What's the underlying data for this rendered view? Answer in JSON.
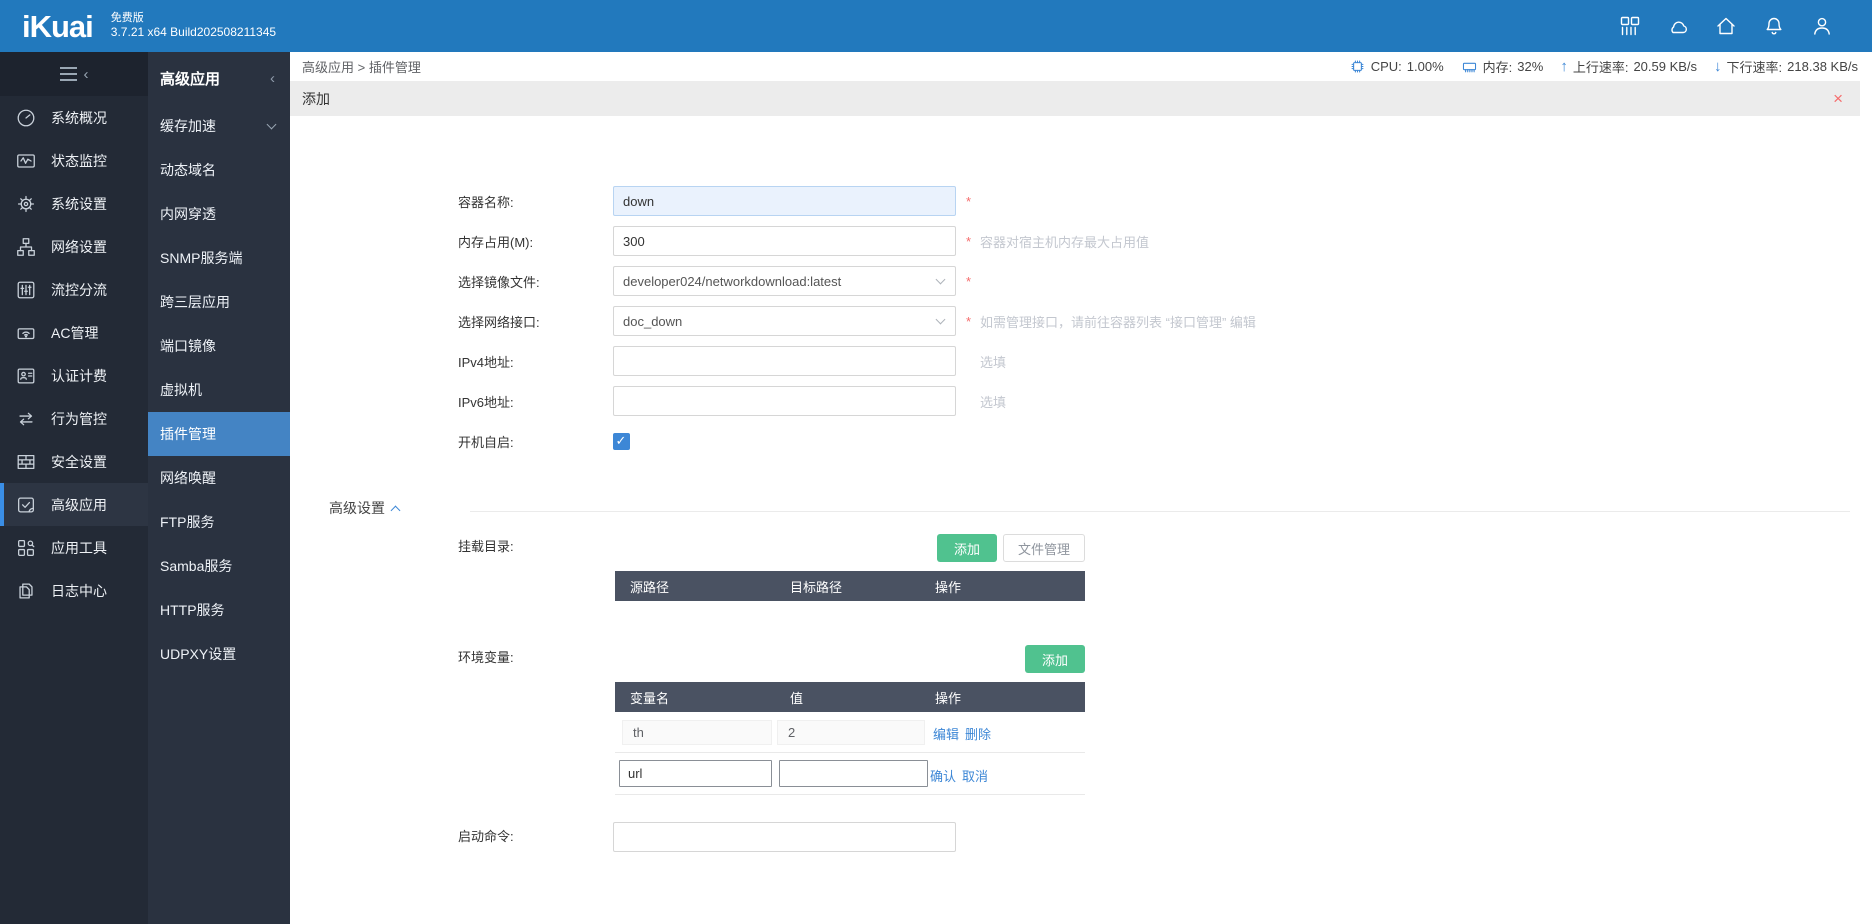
{
  "topbar": {
    "logo": "iKuai",
    "edition": "免费版",
    "version": "3.7.21 x64 Build202508211345"
  },
  "sidebar": {
    "items": [
      {
        "label": "系统概况",
        "icon": "gauge-icon"
      },
      {
        "label": "状态监控",
        "icon": "monitor-pulse-icon"
      },
      {
        "label": "系统设置",
        "icon": "gear-icon"
      },
      {
        "label": "网络设置",
        "icon": "network-icon"
      },
      {
        "label": "流控分流",
        "icon": "sliders-icon"
      },
      {
        "label": "AC管理",
        "icon": "wifi-device-icon"
      },
      {
        "label": "认证计费",
        "icon": "id-card-icon"
      },
      {
        "label": "行为管控",
        "icon": "swap-arrows-icon"
      },
      {
        "label": "安全设置",
        "icon": "firewall-icon"
      },
      {
        "label": "高级应用",
        "icon": "app-check-icon",
        "active": true
      },
      {
        "label": "应用工具",
        "icon": "tools-icon"
      },
      {
        "label": "日志中心",
        "icon": "logs-icon"
      }
    ]
  },
  "submenu": {
    "title": "高级应用",
    "active": "插件管理",
    "items": [
      "缓存加速",
      "动态域名",
      "内网穿透",
      "SNMP服务端",
      "跨三层应用",
      "端口镜像",
      "虚拟机",
      "插件管理",
      "网络唤醒",
      "FTP服务",
      "Samba服务",
      "HTTP服务",
      "UDPXY设置"
    ]
  },
  "header": {
    "breadcrumb": "高级应用 > 插件管理",
    "status": [
      {
        "label": "CPU:",
        "value": "1.00%"
      },
      {
        "label": "内存:",
        "value": "32%"
      },
      {
        "label": "上行速率:",
        "value": "20.59 KB/s"
      },
      {
        "label": "下行速率:",
        "value": "218.38 KB/s"
      }
    ]
  },
  "panel": {
    "title": "添加",
    "close": "×"
  },
  "form": {
    "rows": [
      {
        "label": "容器名称:",
        "value": "down",
        "required": "*"
      },
      {
        "label": "内存占用(M):",
        "value": "300",
        "required": "*",
        "hint": "容器对宿主机内存最大占用值"
      },
      {
        "label": "选择镜像文件:",
        "value": "developer024/networkdownload:latest",
        "required": "*"
      },
      {
        "label": "选择网络接口:",
        "value": "doc_down",
        "required": "*",
        "hint": "如需管理接口，请前往容器列表 “接口管理” 编辑"
      },
      {
        "label": "IPv4地址:",
        "value": "",
        "hint": "选填"
      },
      {
        "label": "IPv6地址:",
        "value": "",
        "hint": "选填"
      },
      {
        "label": "开机自启:",
        "checked": true
      }
    ]
  },
  "advanced": {
    "title": "高级设置",
    "mount": {
      "label": "挂载目录:",
      "add_button": "添加",
      "file_button": "文件管理",
      "headers": [
        "源路径",
        "目标路径",
        "操作"
      ]
    },
    "env": {
      "label": "环境变量:",
      "add_button": "添加",
      "headers": [
        "变量名",
        "值",
        "操作"
      ],
      "row": {
        "name": "th",
        "value": "2",
        "edit": "编辑",
        "delete": "删除"
      },
      "editing": {
        "name": "url",
        "value": "",
        "confirm": "确认",
        "cancel": "取消"
      }
    },
    "command": {
      "label": "启动命令:",
      "value": ""
    }
  },
  "colors": {
    "topbar": "#2279bd",
    "submenu_active": "#4484c4",
    "accent_green": "#50c28f",
    "link_blue": "#3d87d6",
    "danger_red": "#f56c6c",
    "table_header": "#4a5262"
  }
}
